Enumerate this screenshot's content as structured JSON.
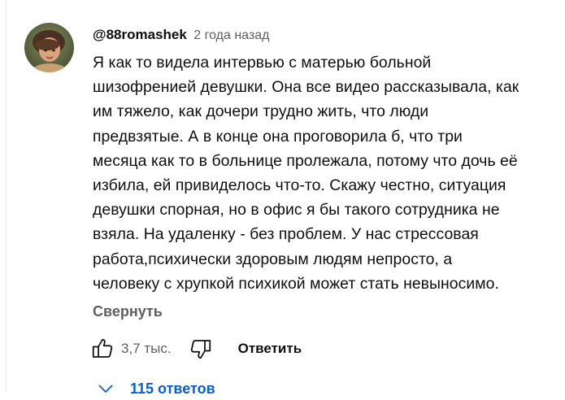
{
  "comment": {
    "author": "@88romashek",
    "timestamp": "2 года назад",
    "text": "Я как то видела интервью с матерью больной\nшизофренией девушки. Она все видео рассказывала, как\nим тяжело, как дочери трудно жить, что люди\nпредвзятые. А в конце она проговорила б, что три\nмесяца как то в больнице пролежала, потому что дочь её\nизбила, ей привиделось что-то. Скажу честно, ситуация\nдевушки спорная, но в офис я бы такого сотрудника не\nвзяла. На удаленку - без проблем. У нас стрессовая\nработа,психически здоровым людям непросто, а\nчеловеку с хрупкой психикой может стать невыносимо.",
    "collapse_label": "Свернуть",
    "like_count": "3,7 тыс.",
    "reply_label": "Ответить",
    "replies_label": "115 ответов"
  },
  "icons": {
    "like": "thumbs-up-icon",
    "dislike": "thumbs-down-icon",
    "expand": "chevron-down-icon"
  },
  "colors": {
    "link_blue": "#065fd4",
    "secondary_text": "#606060",
    "primary_text": "#0f0f0f"
  }
}
